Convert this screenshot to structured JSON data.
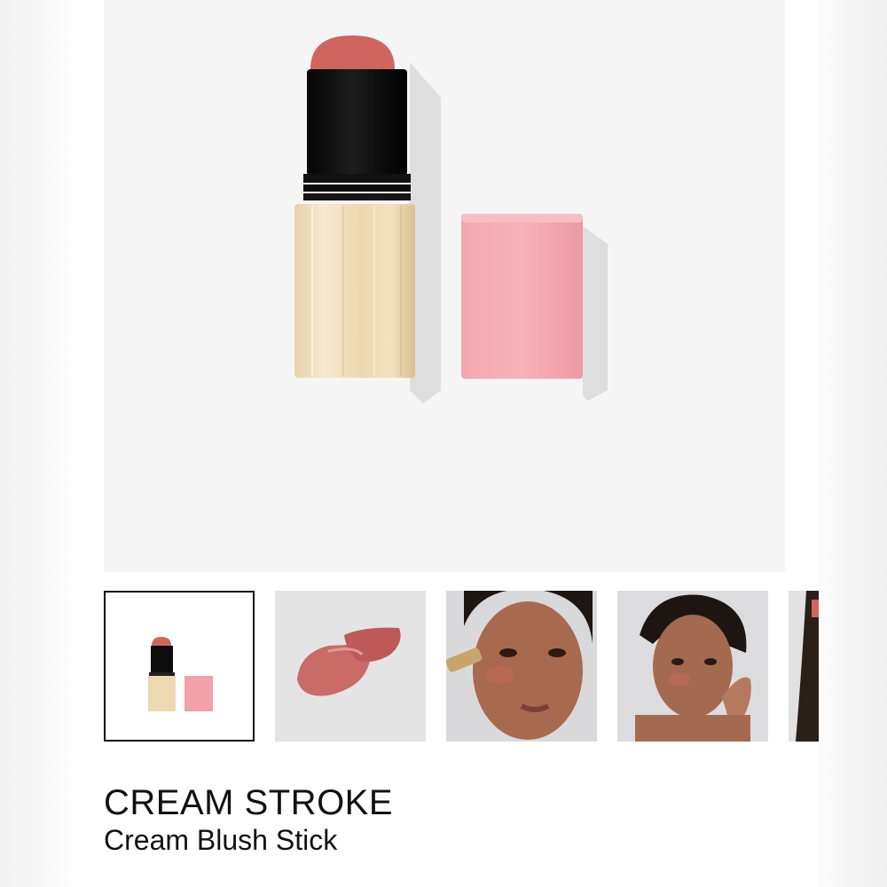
{
  "product": {
    "name": "CREAM STROKE",
    "type": "Cream Blush Stick"
  },
  "gallery": {
    "selected_index": 0,
    "thumbnails": [
      {
        "icon": "blush-stick-product-image",
        "selected": true
      },
      {
        "icon": "blush-swatch-image",
        "selected": false
      },
      {
        "icon": "model-applying-blush-image",
        "selected": false
      },
      {
        "icon": "model-touching-cheek-image",
        "selected": false
      },
      {
        "icon": "partial-product-image",
        "selected": false
      }
    ]
  },
  "colors": {
    "blush_shade": "#d0655f",
    "cap_pink": "#f2a0aa",
    "gold_tube": "#eedbb9",
    "background": "#f5f5f6"
  }
}
